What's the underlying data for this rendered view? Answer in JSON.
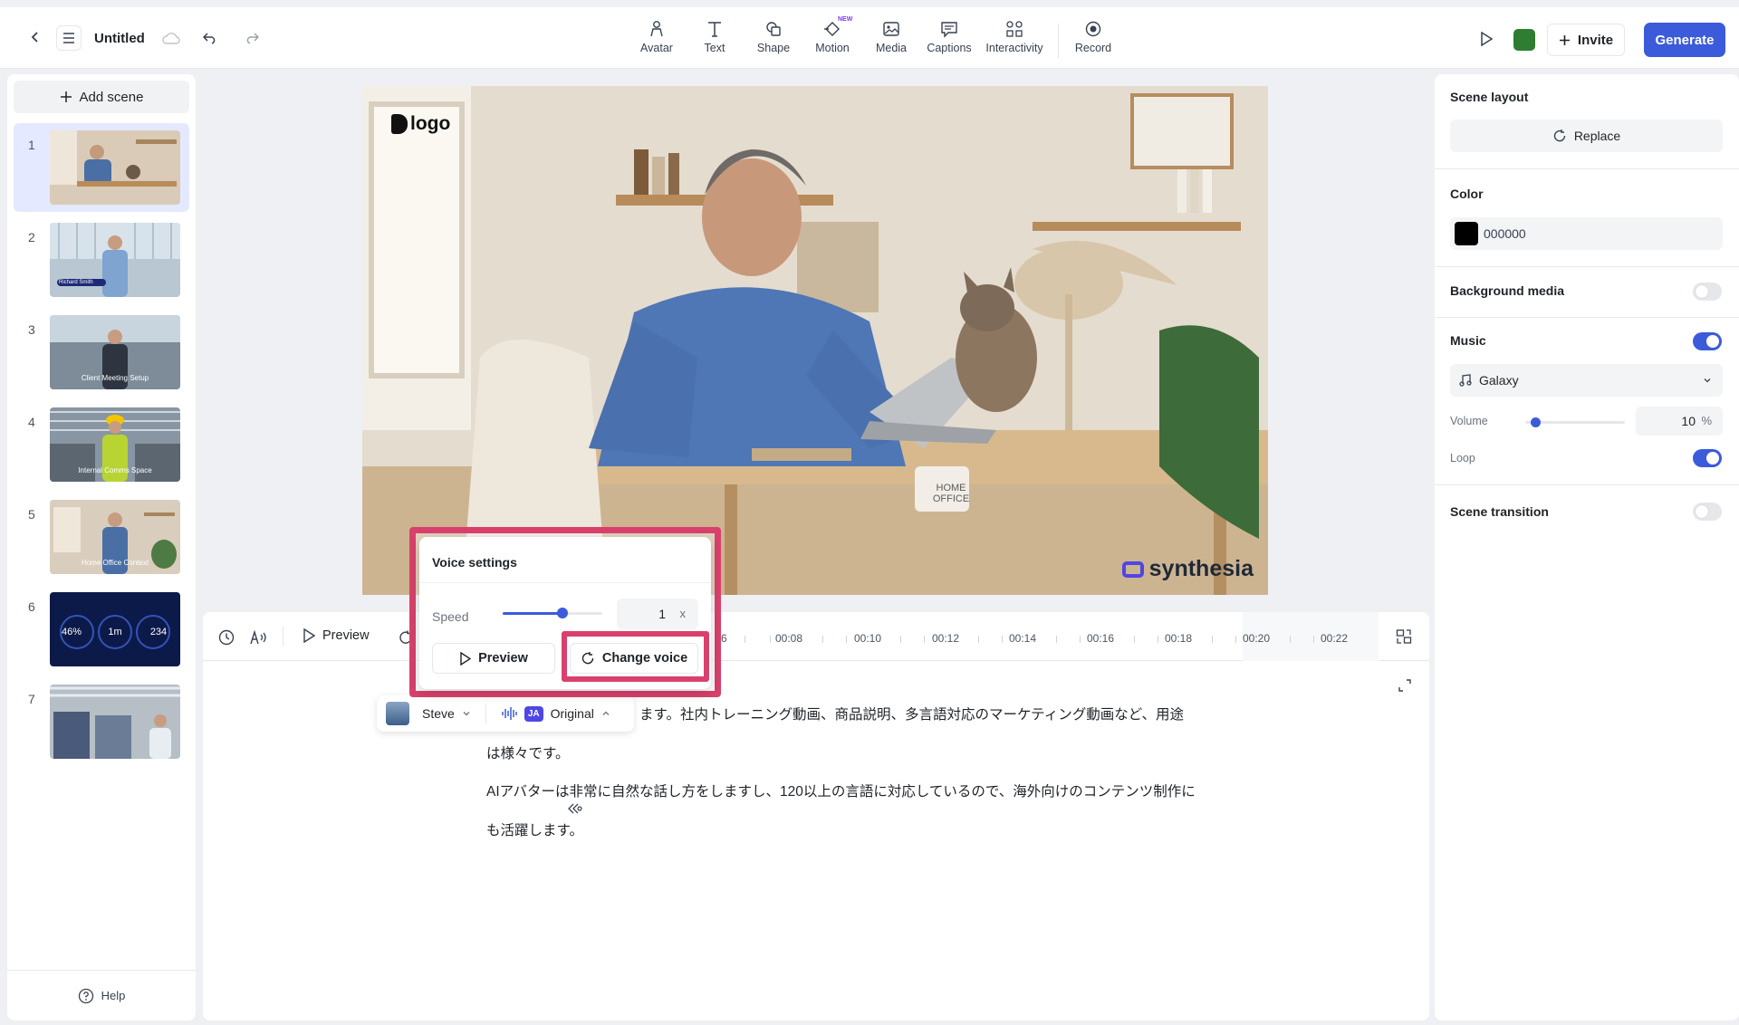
{
  "header": {
    "title": "Untitled",
    "invite_label": "Invite",
    "generate_label": "Generate",
    "new_badge": "NEW",
    "accent": "#3b5bdb",
    "color_chip": "#2e7d32",
    "tools": [
      {
        "label": "Avatar",
        "icon": "avatar-icon"
      },
      {
        "label": "Text",
        "icon": "text-icon"
      },
      {
        "label": "Shape",
        "icon": "shape-icon"
      },
      {
        "label": "Motion",
        "icon": "motion-icon"
      },
      {
        "label": "Media",
        "icon": "media-icon"
      },
      {
        "label": "Captions",
        "icon": "captions-icon"
      },
      {
        "label": "Interactivity",
        "icon": "interactivity-icon"
      },
      {
        "label": "Record",
        "icon": "record-icon"
      }
    ]
  },
  "sidebar": {
    "add_scene_label": "Add scene",
    "help_label": "Help",
    "scenes": [
      {
        "number": "1",
        "caption": ""
      },
      {
        "number": "2",
        "caption": "Richard Smith"
      },
      {
        "number": "3",
        "caption": "Client Meeting Setup"
      },
      {
        "number": "4",
        "caption": "Internal Comms Space"
      },
      {
        "number": "5",
        "caption": "Home Office Context"
      },
      {
        "number": "6",
        "stats": [
          "46%",
          "1m",
          "234"
        ]
      },
      {
        "number": "7",
        "caption": ""
      }
    ]
  },
  "canvas": {
    "logo_text": "logo",
    "watermark": "synthesia",
    "mug_text": "HOME OFFICE"
  },
  "timeline": {
    "preview_label": "Preview",
    "ticks": [
      "6",
      "00:08",
      "00:10",
      "00:12",
      "00:14",
      "00:16",
      "00:18",
      "00:20",
      "00:22"
    ]
  },
  "script": {
    "voice_name": "Steve",
    "lang_badge": "JA",
    "voice_style": "Original",
    "lines": [
      "ます。社内トレーニング動画、商品説明、多言語対応のマーケティング動画など、用途",
      "は様々です。",
      "AIアバターは非常に自然な話し方をしますし、120以上の言語に対応しているので、海外向けのコンテンツ制作に",
      "も活躍します。"
    ]
  },
  "voice_settings": {
    "title": "Voice settings",
    "speed_label": "Speed",
    "speed_value": "1",
    "speed_unit": "x",
    "speed_fraction": 0.6,
    "preview_label": "Preview",
    "change_voice_label": "Change voice",
    "highlight_color": "#d9416c"
  },
  "right_panel": {
    "scene_layout_label": "Scene layout",
    "replace_label": "Replace",
    "color_label": "Color",
    "color_value": "000000",
    "background_media_label": "Background media",
    "background_media_on": false,
    "music_label": "Music",
    "music_on": true,
    "music_track": "Galaxy",
    "volume_label": "Volume",
    "volume_value": "10",
    "volume_unit": "%",
    "volume_fraction": 0.1,
    "loop_label": "Loop",
    "loop_on": true,
    "scene_transition_label": "Scene transition",
    "scene_transition_on": false
  }
}
